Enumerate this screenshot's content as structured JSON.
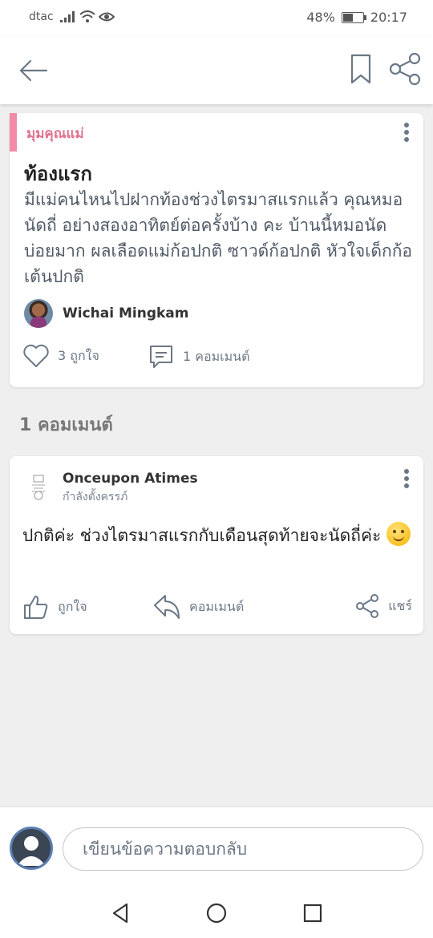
{
  "status_bar": {
    "carrier": "dtac",
    "battery": "48%",
    "time": "20:17"
  },
  "app_bar": {
    "icons": [
      "back-arrow-icon",
      "bookmark-icon",
      "share-icon"
    ]
  },
  "post": {
    "category": "มุมคุณแม่",
    "title": "ท้องแรก",
    "body": "มีแม่คนไหนไปฝากท้องช่วงไตรมาสแรกแล้ว คุณหมอนัดถี่ อย่างสองอาทิตย์ต่อครั้งบ้าง คะ บ้านนี้หมอนัดบ่อยมาก ผลเลือดแม่ก้อปกติ ซาวด์ก้อปกติ หัวใจเด็กก้อเต้นปกติ",
    "author": "Wichai Mingkam",
    "likes": "3 ถูกใจ",
    "comments": "1 คอมเมนต์"
  },
  "comments_section": {
    "title": "1 คอมเมนต์"
  },
  "comment": {
    "author": "Onceupon Atimes",
    "status": "กำลังตั้งครรภ์",
    "text": "ปกติค่ะ ช่วงไตรมาสแรกกับเดือนสุดท้ายจะนัดถี่ค่ะ",
    "like_label": "ถูกใจ",
    "reply_label": "คอมเมนต์",
    "share_label": "แชร์"
  },
  "composer": {
    "placeholder": "เขียนข้อความตอบกลับ"
  },
  "colors": {
    "accent_pink": "#f28ba8",
    "icon_gray": "#6b7785"
  }
}
